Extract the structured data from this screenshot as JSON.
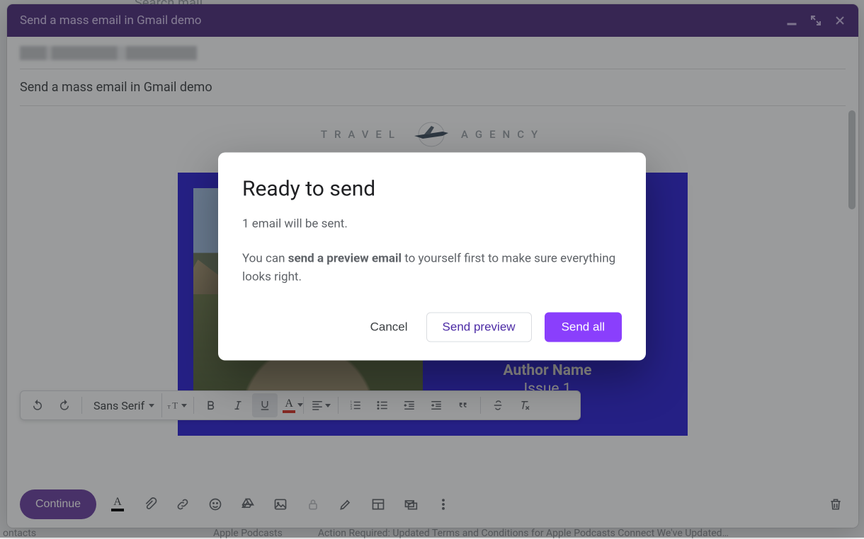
{
  "background": {
    "search_placeholder": "Search mail",
    "footer_items": [
      "ontacts",
      "Apple Podcasts",
      "Action Required: Updated Terms and Conditions for Apple Podcasts Connect  We've Updated…"
    ]
  },
  "compose": {
    "title": "Send a mass email in Gmail demo",
    "subject": "Send a mass email in Gmail demo",
    "template": {
      "logo_left": "TRAVEL",
      "logo_right": "AGENCY",
      "author_label": "Author Name",
      "issue_label": "Issue 1"
    },
    "continue_label": "Continue",
    "font_name": "Sans Serif"
  },
  "modal": {
    "title": "Ready to send",
    "count_line": "1 email will be sent.",
    "body_prefix": "You can ",
    "body_bold": "send a preview email",
    "body_suffix": " to yourself first to make sure everything looks right.",
    "cancel": "Cancel",
    "preview": "Send preview",
    "send_all": "Send all"
  },
  "icons": {
    "minimize": "minimize",
    "fullscreen": "exit-fullscreen",
    "close": "close"
  },
  "colors": {
    "titlebar": "#4b2a7a",
    "primary": "#8a3ffc",
    "hero": "#2b1fd6"
  }
}
